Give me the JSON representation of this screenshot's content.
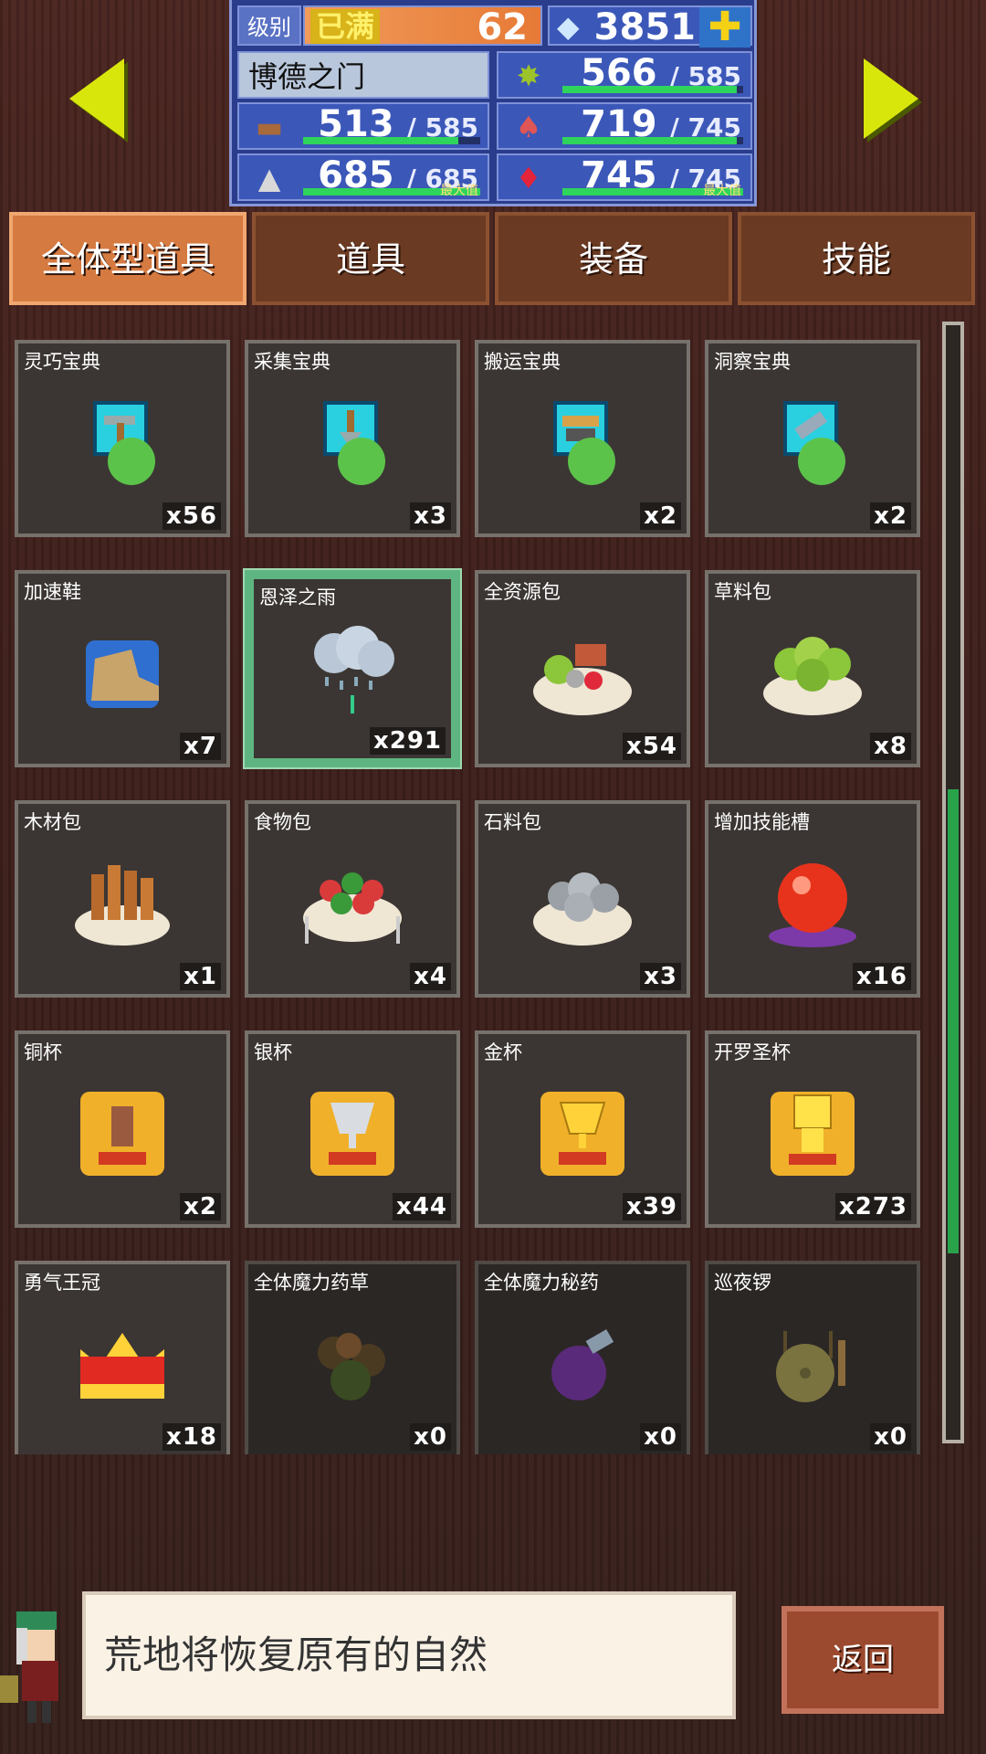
{
  "hud": {
    "level_label": "级别",
    "level_tag": "已满",
    "level_value": "62",
    "gems": "3851",
    "place_name": "博德之门",
    "resources": [
      {
        "icon": "wood-icon",
        "value": "513",
        "max": "585",
        "max_tag": "",
        "fill": 0.877
      },
      {
        "icon": "stone-icon",
        "value": "685",
        "max": "685",
        "max_tag": "最大值",
        "fill": 1.0
      },
      {
        "icon": "grass-icon",
        "value": "566",
        "max": "585",
        "max_tag": "",
        "fill": 0.967
      },
      {
        "icon": "food-icon",
        "value": "719",
        "max": "745",
        "max_tag": "",
        "fill": 0.965
      },
      {
        "icon": "crystal-icon",
        "value": "745",
        "max": "745",
        "max_tag": "最大值",
        "fill": 1.0
      }
    ]
  },
  "tabs": [
    "全体型道具",
    "道具",
    "装备",
    "技能"
  ],
  "items": [
    {
      "name": "灵巧宝典",
      "count": "x56",
      "icon": "hammer-book-icon"
    },
    {
      "name": "采集宝典",
      "count": "x3",
      "icon": "shovel-book-icon"
    },
    {
      "name": "搬运宝典",
      "count": "x2",
      "icon": "cart-book-icon"
    },
    {
      "name": "洞察宝典",
      "count": "x2",
      "icon": "telescope-book-icon"
    },
    {
      "name": "加速鞋",
      "count": "x7",
      "icon": "boot-icon"
    },
    {
      "name": "恩泽之雨",
      "count": "x291",
      "icon": "rain-cloud-icon"
    },
    {
      "name": "全资源包",
      "count": "x54",
      "icon": "resource-bowl-icon"
    },
    {
      "name": "草料包",
      "count": "x8",
      "icon": "grass-bowl-icon"
    },
    {
      "name": "木材包",
      "count": "x1",
      "icon": "wood-bowl-icon"
    },
    {
      "name": "食物包",
      "count": "x4",
      "icon": "food-bowl-icon"
    },
    {
      "name": "石料包",
      "count": "x3",
      "icon": "stone-bowl-icon"
    },
    {
      "name": "增加技能槽",
      "count": "x16",
      "icon": "red-orb-icon"
    },
    {
      "name": "铜杯",
      "count": "x2",
      "icon": "bronze-cup-icon"
    },
    {
      "name": "银杯",
      "count": "x44",
      "icon": "silver-cup-icon"
    },
    {
      "name": "金杯",
      "count": "x39",
      "icon": "gold-cup-icon"
    },
    {
      "name": "开罗圣杯",
      "count": "x273",
      "icon": "kairo-trophy-icon"
    },
    {
      "name": "勇气王冠",
      "count": "x18",
      "icon": "crown-icon"
    },
    {
      "name": "全体魔力药草",
      "count": "x0",
      "icon": "herb-icon"
    },
    {
      "name": "全体魔力秘药",
      "count": "x0",
      "icon": "potion-icon"
    },
    {
      "name": "巡夜锣",
      "count": "x0",
      "icon": "gong-icon"
    }
  ],
  "message": "荒地将恢复原有的自然",
  "back_label": "返回",
  "colors": {
    "accent": "#d57a41",
    "bar_fill": "#2fd45c",
    "scroll": "#29a34a",
    "selected": "#5fb581"
  }
}
